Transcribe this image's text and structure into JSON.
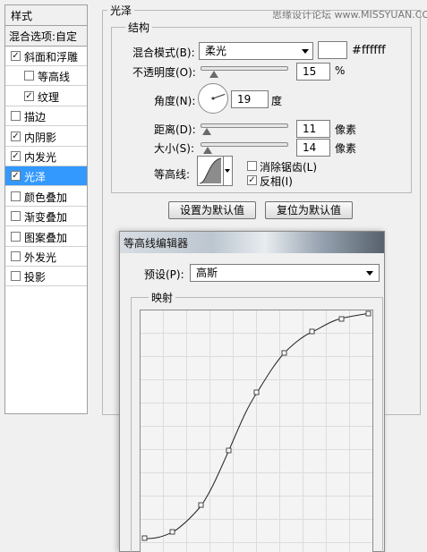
{
  "watermark": "思缘设计论坛 www.MISSYUAN.COM",
  "styles_panel": {
    "header": "样式",
    "blend_options": "混合选项:自定",
    "items": [
      {
        "label": "斜面和浮雕",
        "checked": true,
        "indent": false,
        "selected": false
      },
      {
        "label": "等高线",
        "checked": false,
        "indent": true,
        "selected": false
      },
      {
        "label": "纹理",
        "checked": true,
        "indent": true,
        "selected": false
      },
      {
        "label": "描边",
        "checked": false,
        "indent": false,
        "selected": false
      },
      {
        "label": "内阴影",
        "checked": true,
        "indent": false,
        "selected": false
      },
      {
        "label": "内发光",
        "checked": true,
        "indent": false,
        "selected": false
      },
      {
        "label": "光泽",
        "checked": true,
        "indent": false,
        "selected": true
      },
      {
        "label": "颜色叠加",
        "checked": false,
        "indent": false,
        "selected": false
      },
      {
        "label": "渐变叠加",
        "checked": false,
        "indent": false,
        "selected": false
      },
      {
        "label": "图案叠加",
        "checked": false,
        "indent": false,
        "selected": false
      },
      {
        "label": "外发光",
        "checked": false,
        "indent": false,
        "selected": false
      },
      {
        "label": "投影",
        "checked": false,
        "indent": false,
        "selected": false
      }
    ],
    "check_mark": "✓",
    "selected_color": "#3399ff"
  },
  "satin": {
    "group_title": "光泽",
    "structure_title": "结构",
    "blend_mode_label": "混合模式(B):",
    "blend_mode_value": "柔光",
    "color_hex": "#ffffff",
    "opacity_label": "不透明度(O):",
    "opacity_value": "15",
    "opacity_unit": "%",
    "opacity_fraction": 0.15,
    "angle_label": "角度(N):",
    "angle_value": "19",
    "angle_unit": "度",
    "distance_label": "距离(D):",
    "distance_value": "11",
    "distance_unit": "像素",
    "size_label": "大小(S):",
    "size_value": "14",
    "size_unit": "像素",
    "contour_label": "等高线:",
    "anti_alias_label": "消除锯齿(L)",
    "anti_alias_checked": false,
    "invert_label": "反相(I)",
    "invert_checked": true,
    "set_default_button": "设置为默认值",
    "reset_default_button": "复位为默认值"
  },
  "contour_editor": {
    "title": "等高线编辑器",
    "preset_label": "预设(P):",
    "preset_value": "高斯",
    "mapping_title": "映射"
  },
  "icons": {
    "dropdown": "chevron-down-icon",
    "angle_dial": "angle-dial-icon",
    "contour_preview": "contour-preview-icon"
  }
}
